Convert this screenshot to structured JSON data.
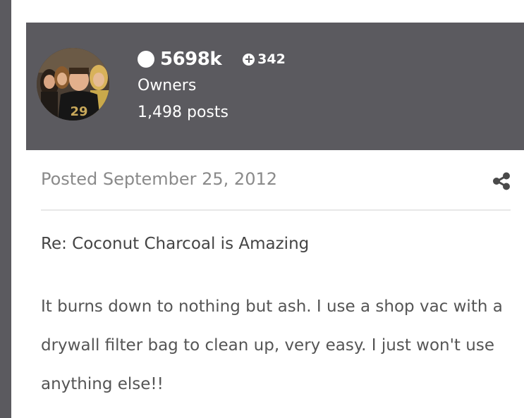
{
  "author": {
    "reputation": "5698k",
    "plus_count": "342",
    "group": "Owners",
    "posts": "1,498 posts"
  },
  "post": {
    "posted": "Posted September 25, 2012",
    "subject": "Re: Coconut Charcoal is Amazing",
    "body": "It burns down to nothing but ash. I use a shop vac with a drywall filter bag to clean up, very easy. I just won't use anything else!!"
  },
  "icons": {
    "share": "share-icon",
    "reputation": "reputation-dot-icon",
    "plus": "plus-circle-icon"
  },
  "colors": {
    "panel_bg": "#5b5a5f",
    "text_light": "#ffffff",
    "muted_text": "#8a8a8a"
  }
}
